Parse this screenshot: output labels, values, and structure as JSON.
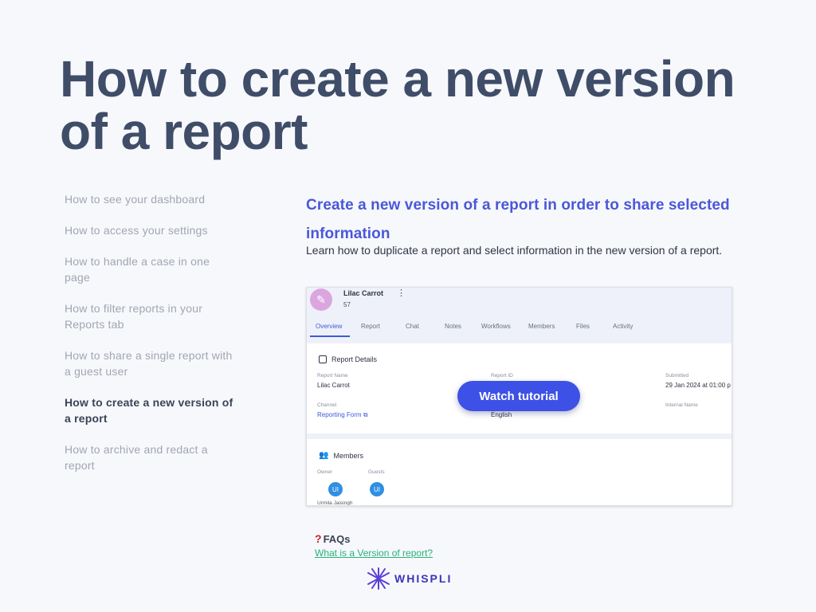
{
  "title": "How to create a new version of a report",
  "sidebar": {
    "items": [
      {
        "label": "How to see your dashboard"
      },
      {
        "label": "How to access your settings"
      },
      {
        "label": "How to handle a case in one page"
      },
      {
        "label": "How to filter reports in your Reports tab"
      },
      {
        "label": "How to share a single report with a guest user"
      },
      {
        "label": "How to create a new version of a report",
        "active": true
      },
      {
        "label": "How to archive and redact a report"
      }
    ]
  },
  "content": {
    "heading": "Create a new version of a report in order to share selected information",
    "description": "Learn how to duplicate a report and select information in the new version of a report."
  },
  "video": {
    "report_name": "Lilac Carrot",
    "report_number": "57",
    "tabs": [
      "Overview",
      "Report",
      "Chat",
      "Notes",
      "Workflows",
      "Members",
      "Files",
      "Activity"
    ],
    "details_title": "Report Details",
    "fields": {
      "report_name_label": "Report Name",
      "report_name_value": "Lilac Carrot",
      "report_id_label": "Report ID",
      "submitted_label": "Submitted",
      "submitted_value": "29 Jan 2024 at 01:00 p",
      "channel_label": "Channel",
      "channel_value": "Reporting Form",
      "language_value": "English",
      "internal_name_label": "Internal Name"
    },
    "members_title": "Members",
    "owner_label": "Owner",
    "guests_label": "Guests",
    "owner_initials": "UI",
    "guest_initials": "UI",
    "owner_name": "Urmila Jaisingh",
    "watch_button": "Watch tutorial"
  },
  "faq": {
    "title": "FAQs",
    "link": "What is a Version of  report?"
  },
  "logo": {
    "text": "WHISPLI"
  },
  "colors": {
    "accent": "#3d51e6",
    "heading": "#4a58d8",
    "link": "#27b27a"
  }
}
